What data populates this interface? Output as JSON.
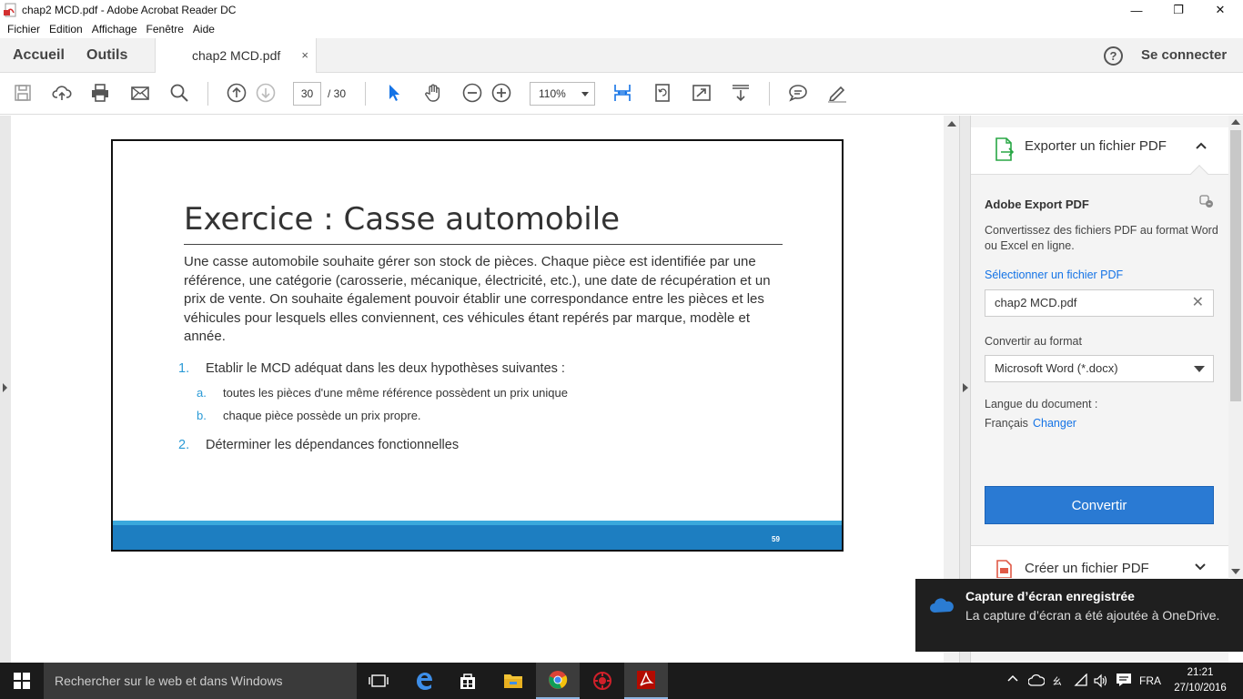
{
  "window": {
    "title": "chap2 MCD.pdf - Adobe Acrobat Reader DC",
    "minimize": "—",
    "maximize": "❐",
    "close": "✕"
  },
  "menu": [
    "Fichier",
    "Edition",
    "Affichage",
    "Fenêtre",
    "Aide"
  ],
  "nav": {
    "home": "Accueil",
    "tools": "Outils",
    "doc_tab": "chap2 MCD.pdf",
    "doc_tab_close": "×",
    "help": "?",
    "signin": "Se connecter"
  },
  "toolbar": {
    "page_current": "30",
    "page_total": "/  30",
    "zoom": "110%"
  },
  "slide": {
    "title": "Exercice : Casse automobile",
    "paragraph": "Une casse automobile souhaite gérer son stock de pièces. Chaque pièce est identifiée par une référence, une catégorie (carosserie, mécanique, électricité, etc.), une date de récupération et un prix de vente. On souhaite également pouvoir établir une correspondance entre les pièces et les véhicules pour lesquels elles conviennent, ces véhicules étant repérés par marque, modèle et année.",
    "items": [
      {
        "num": "1.",
        "text": "Etablir le MCD adéquat dans les deux hypothèses suivantes :"
      },
      {
        "num": "2.",
        "text": "Déterminer les dépendances fonctionnelles"
      }
    ],
    "subitems": [
      {
        "num": "a.",
        "text": "toutes les pièces d'une même référence possèdent un prix unique"
      },
      {
        "num": "b.",
        "text": "chaque pièce possède un prix propre."
      }
    ],
    "page_number": "59"
  },
  "right_panel": {
    "export_header": "Exporter un fichier PDF",
    "service_title": "Adobe Export PDF",
    "description": "Convertissez des fichiers PDF au format Word ou Excel en ligne.",
    "select_file_link": "Sélectionner un fichier PDF",
    "selected_file": "chap2 MCD.pdf",
    "convert_to_label": "Convertir au format",
    "format_value": "Microsoft Word (*.docx)",
    "language_label": "Langue du document :",
    "language_value": "Français",
    "change_link": "Changer",
    "convert_button": "Convertir",
    "create_header": "Créer un fichier PDF"
  },
  "toast": {
    "title": "Capture d’écran enregistrée",
    "body": "La capture d’écran a été ajoutée à OneDrive."
  },
  "taskbar": {
    "search_placeholder": "Rechercher sur le web et dans Windows",
    "lang": "FRA",
    "time": "21:21",
    "date": "27/10/2016"
  },
  "colors": {
    "accent_blue": "#2a7ad3",
    "slide_band_light": "#3aa8dc",
    "slide_band_dark": "#1d7ec1",
    "list_number": "#2a9ad6",
    "link": "#1473e6"
  }
}
